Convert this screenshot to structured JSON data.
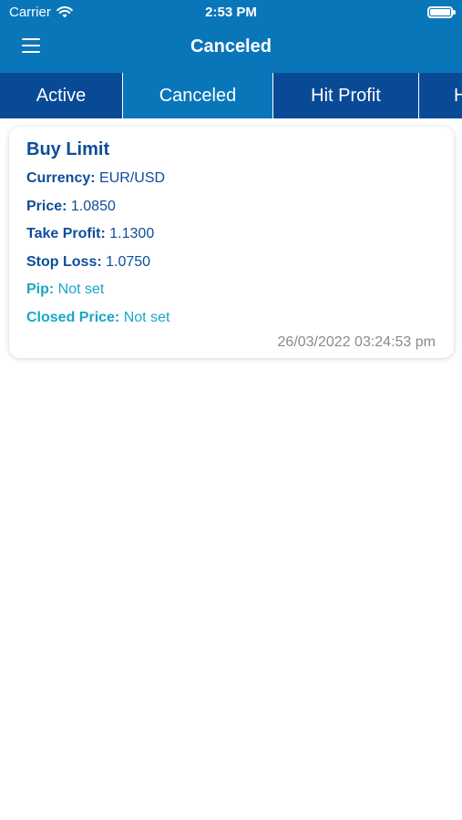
{
  "status_bar": {
    "carrier": "Carrier",
    "time": "2:53 PM"
  },
  "header": {
    "title": "Canceled"
  },
  "tabs": [
    {
      "label": "Active",
      "selected": false
    },
    {
      "label": "Canceled",
      "selected": true
    },
    {
      "label": "Hit Profit",
      "selected": false
    },
    {
      "label": "H",
      "selected": false
    }
  ],
  "order": {
    "type": "Buy Limit",
    "fields": [
      {
        "label": "Currency:",
        "value": "EUR/USD"
      },
      {
        "label": "Price:",
        "value": "1.0850"
      },
      {
        "label": "Take Profit:",
        "value": "1.1300"
      },
      {
        "label": "Stop Loss:",
        "value": "1.0750"
      },
      {
        "label": "Pip:",
        "value": "Not set"
      },
      {
        "label": "Closed Price:",
        "value": "Not set"
      }
    ],
    "timestamp": "26/03/2022 03:24:53 pm"
  },
  "colors": {
    "header_blue": "#0a76ba",
    "tab_bar_blue": "#094a96",
    "label_dark_blue": "#0d4e9a",
    "label_teal": "#1aa6c6",
    "timestamp_gray": "#8a8a8a"
  },
  "icons": {
    "wifi": "wifi-icon",
    "battery": "battery-icon",
    "menu": "hamburger-menu-icon"
  }
}
